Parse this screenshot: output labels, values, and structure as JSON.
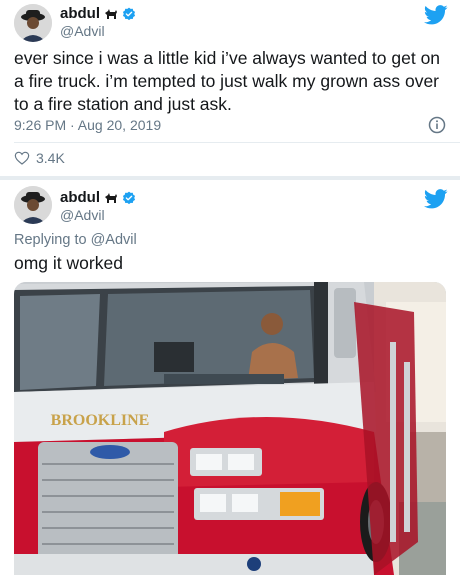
{
  "tweets": [
    {
      "author_name": "abdul",
      "handle": "@Advil",
      "text": "ever since i was a little kid i’ve always wanted to get on a fire truck. i’m tempted to just walk my grown ass over to a fire station and just ask.",
      "timestamp": "9:26 PM · Aug 20, 2019",
      "likes": "3.4K"
    },
    {
      "author_name": "abdul",
      "handle": "@Advil",
      "reply_prefix": "Replying to",
      "reply_handle": "@Advil",
      "text": "omg it worked",
      "photo_text": "BROOKLINE"
    }
  ],
  "colors": {
    "twitter_blue": "#1da1f2",
    "secondary_text": "#657786",
    "truck_red": "#c8102e"
  },
  "icons": {
    "brand": "twitter-bird-icon",
    "verified": "verified-badge-icon",
    "emoji": "dog-emoji-icon",
    "info": "info-icon",
    "like": "heart-icon"
  }
}
